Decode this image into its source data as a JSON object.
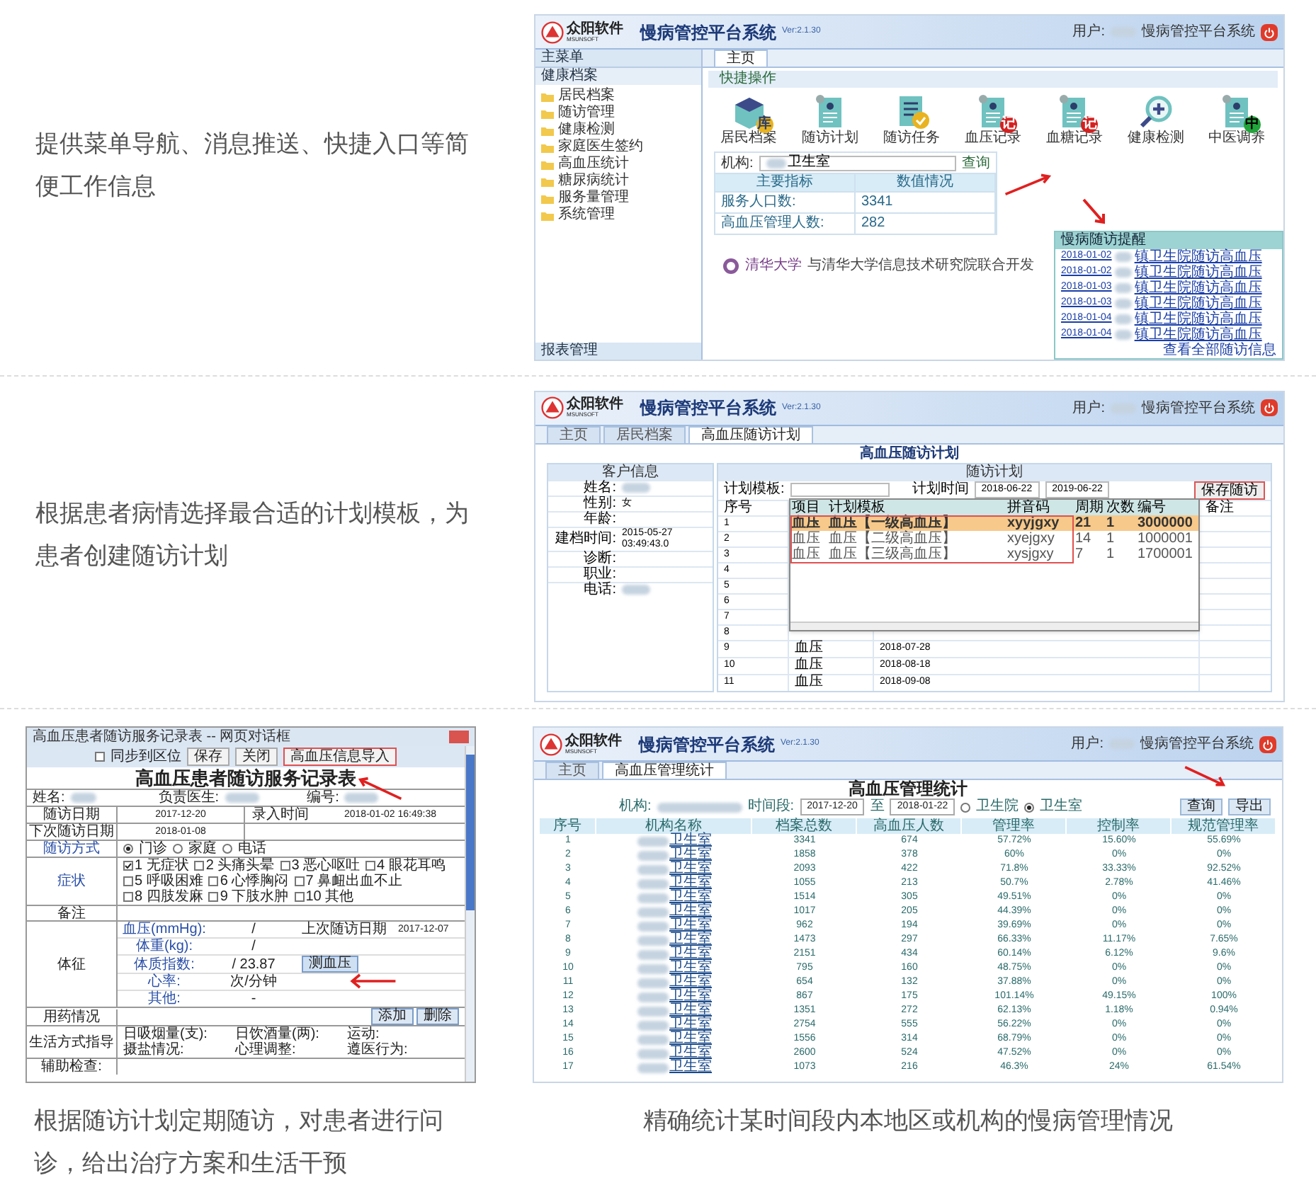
{
  "captions": [
    "提供菜单导航、消息推送、快捷入口等简便工作信息",
    "根据患者病情选择最合适的计划模板，为患者创建随访计划",
    "根据随访计划定期随访，对患者进行问诊，给出治疗方案和生活干预",
    "精确统计某时间段内本地区或机构的慢病管理情况"
  ],
  "home_screen": {
    "header": {
      "logo_text": "众阳软件",
      "logo_sub": "MSUNSOFT",
      "system_name": "慢病管控平台系统",
      "version": "Ver:2.1.30",
      "user_label": "用户:",
      "user_system": "慢病管控平台系统"
    },
    "sidebar": {
      "title": "主菜单",
      "section": "健康档案",
      "items": [
        "居民档案",
        "随访管理",
        "健康检测",
        "家庭医生签约",
        "高血压统计",
        "糖尿病统计",
        "服务量管理",
        "系统管理"
      ],
      "footer": "报表管理"
    },
    "tabs": [
      {
        "label": "主页",
        "selected": true
      }
    ],
    "panel_title": "快捷操作",
    "shortcuts": [
      {
        "label": "居民档案",
        "kind": "box",
        "badge": "库"
      },
      {
        "label": "随访计划",
        "kind": "doc"
      },
      {
        "label": "随访任务",
        "kind": "check"
      },
      {
        "label": "血压记录",
        "kind": "record",
        "badge": "记"
      },
      {
        "label": "血糖记录",
        "kind": "record",
        "badge": "记"
      },
      {
        "label": "健康检测",
        "kind": "magnifier"
      },
      {
        "label": "中医调养",
        "kind": "tcm",
        "badge": "中"
      }
    ],
    "search": {
      "label": "机构:",
      "value": "卫生室",
      "button": "查询"
    },
    "indicators": {
      "columns": [
        "主要指标",
        "数值情况"
      ],
      "rows": [
        [
          "服务人口数:",
          "3341"
        ],
        [
          "高血压管理人数:",
          "282"
        ]
      ]
    },
    "reminder": {
      "title": "慢病随访提醒",
      "items": [
        {
          "date": "2018-01-02",
          "text": "镇卫生院随访高血压"
        },
        {
          "date": "2018-01-02",
          "text": "镇卫生院随访高血压"
        },
        {
          "date": "2018-01-03",
          "text": "镇卫生院随访高血压"
        },
        {
          "date": "2018-01-03",
          "text": "镇卫生院随访高血压"
        },
        {
          "date": "2018-01-04",
          "text": "镇卫生院随访高血压"
        },
        {
          "date": "2018-01-04",
          "text": "镇卫生院随访高血压"
        }
      ],
      "more": "查看全部随访信息"
    },
    "footer": {
      "org": "清华大学",
      "text": "与清华大学信息技术研究院联合开发"
    }
  },
  "plan_screen": {
    "header": {
      "logo_text": "众阳软件",
      "logo_sub": "MSUNSOFT",
      "system_name": "慢病管控平台系统",
      "version": "Ver:2.1.30",
      "user_label": "用户:",
      "user_system": "慢病管控平台系统"
    },
    "tabs": [
      {
        "label": "主页",
        "selected": false
      },
      {
        "label": "居民档案",
        "selected": false
      },
      {
        "label": "高血压随访计划",
        "selected": true
      }
    ],
    "title": "高血压随访计划",
    "customer": {
      "title": "客户信息",
      "fields": [
        {
          "label": "姓名:",
          "blurred": true
        },
        {
          "label": "性别:",
          "value": "女"
        },
        {
          "label": "年龄:"
        },
        {
          "label": "建档时间:",
          "value": "2015-05-27 03:49:43.0"
        },
        {
          "label": "诊断:"
        },
        {
          "label": "职业:"
        },
        {
          "label": "电话:",
          "blurred": true
        }
      ]
    },
    "plan": {
      "title": "随访计划",
      "template_label": "计划模板:",
      "time_label": "计划时间",
      "start": "2018-06-22",
      "end": "2019-06-22",
      "button": "保存随访"
    },
    "table": {
      "columns": [
        "序号",
        "备注"
      ],
      "rows": [
        {
          "no": "1"
        },
        {
          "no": "2"
        },
        {
          "no": "3"
        },
        {
          "no": "4"
        },
        {
          "no": "5"
        },
        {
          "no": "6"
        },
        {
          "no": "7"
        },
        {
          "no": "8"
        },
        {
          "no": "9",
          "item": "血压",
          "date": "2018-07-28"
        },
        {
          "no": "10",
          "item": "血压",
          "date": "2018-08-18"
        },
        {
          "no": "11",
          "item": "血压",
          "date": "2018-09-08"
        }
      ]
    },
    "dropdown": {
      "columns": [
        "项目",
        "计划模板",
        "拼音码",
        "周期",
        "次数",
        "编号"
      ],
      "rows": [
        {
          "cells": [
            "血压",
            "血压【一级高血压】",
            "xyyjgxy",
            "21",
            "1",
            "3000000"
          ],
          "selected": true
        },
        {
          "cells": [
            "血压",
            "血压【二级高血压】",
            "xyejgxy",
            "14",
            "1",
            "1000001"
          ],
          "selected": false
        },
        {
          "cells": [
            "血压",
            "血压【三级高血压】",
            "xysjgxy",
            "7",
            "1",
            "1700001"
          ],
          "selected": false
        }
      ]
    }
  },
  "record_form": {
    "window_title": "高血压患者随访服务记录表 -- 网页对话框",
    "sync": {
      "label": "同步到区位",
      "checked": false
    },
    "buttons": [
      "保存",
      "关闭",
      "高血压信息导入"
    ],
    "title": "高血压患者随访服务记录表",
    "name_label": "姓名:",
    "doctor_label": "负责医生:",
    "number_label": "编号:",
    "rows": [
      {
        "label": "随访日期",
        "value": "2017-12-20",
        "label2": "录入时间",
        "value2": "2018-01-02 16:49:38"
      },
      {
        "label": "下次随访日期",
        "value": "2018-01-08"
      }
    ],
    "method": {
      "label": "随访方式",
      "options": [
        {
          "label": "门诊",
          "selected": true
        },
        {
          "label": "家庭",
          "selected": false
        },
        {
          "label": "电话",
          "selected": false
        }
      ]
    },
    "symptoms": {
      "label": "症状",
      "options": [
        {
          "label": "1 无症状",
          "checked": true
        },
        {
          "label": "2 头痛头晕",
          "checked": false
        },
        {
          "label": "3 恶心呕吐",
          "checked": false
        },
        {
          "label": "4 眼花耳鸣",
          "checked": false
        },
        {
          "label": "5 呼吸困难",
          "checked": false
        },
        {
          "label": "6 心悸胸闷",
          "checked": false
        },
        {
          "label": "7 鼻衄出血不止",
          "checked": false
        },
        {
          "label": "8 四肢发麻",
          "checked": false
        },
        {
          "label": "9 下肢水肿",
          "checked": false
        },
        {
          "label": "10 其他",
          "checked": false
        }
      ]
    },
    "note_label": "备注",
    "signs": {
      "label": "体征",
      "items": [
        {
          "label": "血压(mmHg):",
          "value": "/"
        },
        {
          "label": "体重(kg):",
          "value": "/"
        },
        {
          "label": "体质指数:",
          "value": "/ 23.87"
        },
        {
          "label": "心率:",
          "value": "次/分钟"
        },
        {
          "label": "其他:",
          "value": "-"
        }
      ],
      "last_label": "上次随访日期",
      "last_value": "2017-12-07",
      "button": "测血压"
    },
    "medication": {
      "label": "用药情况",
      "buttons": [
        "添加",
        "删除"
      ]
    },
    "lifestyle": {
      "label": "生活方式指导",
      "items": [
        "日吸烟量(支):",
        "日饮酒量(两):",
        "运动:",
        "摄盐情况:",
        "心理调整:",
        "遵医行为:"
      ]
    },
    "exam_label": "辅助检查:"
  },
  "stats_screen": {
    "header": {
      "logo_text": "众阳软件",
      "logo_sub": "MSUNSOFT",
      "system_name": "慢病管控平台系统",
      "version": "Ver:2.1.30",
      "user_label": "用户:",
      "user_system": "慢病管控平台系统"
    },
    "tabs": [
      {
        "label": "主页",
        "selected": false
      },
      {
        "label": "高血压管理统计",
        "selected": true
      }
    ],
    "title": "高血压管理统计",
    "filter": {
      "org_label": "机构:",
      "time_label": "时间段:",
      "start": "2017-12-20",
      "to": "至",
      "end": "2018-01-22",
      "types": [
        {
          "label": "卫生院",
          "selected": false
        },
        {
          "label": "卫生室",
          "selected": true
        }
      ],
      "buttons": [
        "查询",
        "导出"
      ]
    },
    "columns": [
      "序号",
      "机构名称",
      "档案总数",
      "高血压人数",
      "管理率",
      "控制率",
      "规范管理率"
    ],
    "rows": [
      [
        "1",
        "卫生室",
        "3341",
        "674",
        "57.72%",
        "15.60%",
        "55.69%"
      ],
      [
        "2",
        "卫生室",
        "1858",
        "378",
        "60%",
        "0%",
        "0%"
      ],
      [
        "3",
        "卫生室",
        "2093",
        "422",
        "71.8%",
        "33.33%",
        "92.52%"
      ],
      [
        "4",
        "卫生室",
        "1055",
        "213",
        "50.7%",
        "2.78%",
        "41.46%"
      ],
      [
        "5",
        "卫生室",
        "1514",
        "305",
        "49.51%",
        "0%",
        "0%"
      ],
      [
        "6",
        "卫生室",
        "1017",
        "205",
        "44.39%",
        "0%",
        "0%"
      ],
      [
        "7",
        "卫生室",
        "962",
        "194",
        "39.69%",
        "0%",
        "0%"
      ],
      [
        "8",
        "卫生室",
        "1473",
        "297",
        "66.33%",
        "11.17%",
        "7.65%"
      ],
      [
        "9",
        "卫生室",
        "2151",
        "434",
        "60.14%",
        "6.12%",
        "9.6%"
      ],
      [
        "10",
        "卫生室",
        "795",
        "160",
        "48.75%",
        "0%",
        "0%"
      ],
      [
        "11",
        "卫生室",
        "654",
        "132",
        "37.88%",
        "0%",
        "0%"
      ],
      [
        "12",
        "卫生室",
        "867",
        "175",
        "101.14%",
        "49.15%",
        "100%"
      ],
      [
        "13",
        "卫生室",
        "1351",
        "272",
        "62.13%",
        "1.18%",
        "0.94%"
      ],
      [
        "14",
        "卫生室",
        "2754",
        "555",
        "56.22%",
        "0%",
        "0%"
      ],
      [
        "15",
        "卫生室",
        "1556",
        "314",
        "68.79%",
        "0%",
        "0%"
      ],
      [
        "16",
        "卫生室",
        "2600",
        "524",
        "47.52%",
        "0%",
        "0%"
      ],
      [
        "17",
        "卫生室",
        "1073",
        "216",
        "46.3%",
        "24%",
        "61.54%"
      ]
    ]
  }
}
